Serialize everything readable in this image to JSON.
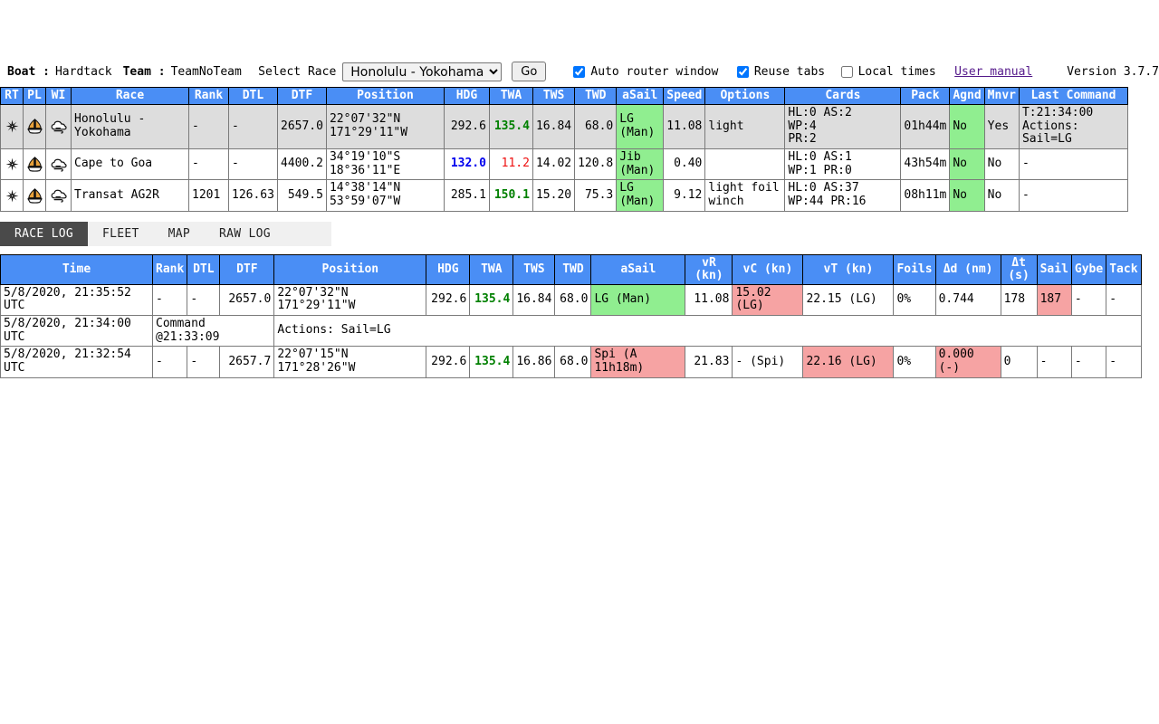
{
  "header": {
    "boat_label": "Boat :",
    "boat_name": "Hardtack",
    "team_label": "Team :",
    "team_name": "TeamNoTeam",
    "select_race_label": "Select Race",
    "selected_race": "Honolulu - Yokohama",
    "race_options": [
      "Honolulu - Yokohama",
      "Cape to Goa",
      "Transat AG2R"
    ],
    "go_label": "Go",
    "auto_router_window_label": "Auto router window",
    "auto_router_window_checked": true,
    "reuse_tabs_label": "Reuse tabs",
    "reuse_tabs_checked": true,
    "local_times_label": "Local times",
    "local_times_checked": false,
    "user_manual_label": "User manual",
    "version_label": "Version 3.7.7"
  },
  "colors": {
    "header_blue": "#4a8ef5",
    "highlight_green": "#90ee90",
    "highlight_pink": "#f6a3a3",
    "row_highlight": "#dddddd",
    "active_tab": "#4a4a4a",
    "value_green": "#008000",
    "value_red": "#ee1111",
    "value_blue": "#0000ee"
  },
  "fleet_table": {
    "columns": [
      "RT",
      "PL",
      "WI",
      "Race",
      "Rank",
      "DTL",
      "DTF",
      "Position",
      "HDG",
      "TWA",
      "TWS",
      "TWD",
      "aSail",
      "Speed",
      "Options",
      "Cards",
      "Pack",
      "Agnd",
      "Mnvr",
      "Last Command"
    ],
    "rows": [
      {
        "selected": true,
        "rt_icon": "compass-rose-icon",
        "pl_icon": "sailboat-icon",
        "wi_icon": "wind-cloud-icon",
        "race": "Honolulu - Yokohama",
        "rank": "-",
        "dtl": "-",
        "dtf": "2657.0",
        "position_lat": "22°07'32\"N",
        "position_lon": "171°29'11\"W",
        "hdg": "292.6",
        "hdg_color": "normal",
        "twa": "135.4",
        "twa_color": "green",
        "tws": "16.84",
        "twd": "68.0",
        "asail": "LG (Man)",
        "asail_hl": "green",
        "speed": "11.08",
        "options": "light",
        "cards": "HL:0 AS:2 WP:4 PR:2",
        "pack": "01h44m",
        "agnd": "No",
        "agnd_hl": "green",
        "mnvr": "Yes",
        "last_command": "T:21:34:00 Actions: Sail=LG"
      },
      {
        "selected": false,
        "rt_icon": "compass-rose-icon",
        "pl_icon": "sailboat-icon",
        "wi_icon": "wind-cloud-icon",
        "race": "Cape to Goa",
        "rank": "-",
        "dtl": "-",
        "dtf": "4400.2",
        "position_lat": "34°19'10\"S",
        "position_lon": "18°36'11\"E",
        "hdg": "132.0",
        "hdg_color": "blue",
        "twa": "11.2",
        "twa_color": "red",
        "tws": "14.02",
        "twd": "120.8",
        "asail": "Jib (Man)",
        "asail_hl": "green",
        "speed": "0.40",
        "options": "",
        "cards": "HL:0 AS:1 WP:1 PR:0",
        "pack": "43h54m",
        "agnd": "No",
        "agnd_hl": "green",
        "mnvr": "No",
        "last_command": "-"
      },
      {
        "selected": false,
        "rt_icon": "compass-rose-icon",
        "pl_icon": "sailboat-icon",
        "wi_icon": "wind-cloud-icon",
        "race": "Transat AG2R",
        "rank": "1201",
        "dtl": "126.63",
        "dtf": "549.5",
        "position_lat": "14°38'14\"N",
        "position_lon": "53°59'07\"W",
        "hdg": "285.1",
        "hdg_color": "normal",
        "twa": "150.1",
        "twa_color": "green",
        "tws": "15.20",
        "twd": "75.3",
        "asail": "LG (Man)",
        "asail_hl": "green",
        "speed": "9.12",
        "options": "light foil winch",
        "cards": "HL:0 AS:37 WP:44 PR:16",
        "pack": "08h11m",
        "agnd": "No",
        "agnd_hl": "green",
        "mnvr": "No",
        "last_command": "-"
      }
    ]
  },
  "tabs": [
    {
      "label": "RACE LOG",
      "active": true
    },
    {
      "label": "FLEET",
      "active": false
    },
    {
      "label": "MAP",
      "active": false
    },
    {
      "label": "RAW LOG",
      "active": false
    }
  ],
  "race_log": {
    "columns": [
      "Time",
      "Rank",
      "DTL",
      "DTF",
      "Position",
      "HDG",
      "TWA",
      "TWS",
      "TWD",
      "aSail",
      "vR (kn)",
      "vC (kn)",
      "vT (kn)",
      "Foils",
      "Δd (nm)",
      "Δt (s)",
      "Sail",
      "Gybe",
      "Tack"
    ],
    "rows": [
      {
        "type": "data",
        "time": "5/8/2020, 21:35:52 UTC",
        "rank": "-",
        "dtl": "-",
        "dtf": "2657.0",
        "position_lat": "22°07'32\"N",
        "position_lon": "171°29'11\"W",
        "hdg": "292.6",
        "twa": "135.4",
        "twa_color": "green",
        "tws": "16.84",
        "twd": "68.0",
        "asail": "LG (Man)",
        "asail_hl": "green",
        "vr": "11.08",
        "vc": "15.02 (LG)",
        "vc_hl": "pink",
        "vt": "22.15 (LG)",
        "foils": "0%",
        "dd": "0.744",
        "dt": "178",
        "sail": "187",
        "sail_hl": "pink",
        "gybe": "-",
        "tack": "-"
      },
      {
        "type": "command",
        "time": "5/8/2020, 21:34:00 UTC",
        "command_label": "Command @21:33:09",
        "actions": "Actions: Sail=LG"
      },
      {
        "type": "data",
        "time": "5/8/2020, 21:32:54 UTC",
        "rank": "-",
        "dtl": "-",
        "dtf": "2657.7",
        "position_lat": "22°07'15\"N",
        "position_lon": "171°28'26\"W",
        "hdg": "292.6",
        "twa": "135.4",
        "twa_color": "green",
        "tws": "16.86",
        "twd": "68.0",
        "asail": "Spi (A 11h18m)",
        "asail_hl": "pink",
        "vr": "21.83",
        "vc": "- (Spi)",
        "vc_hl": "none",
        "vt": "22.16 (LG)",
        "vt_hl": "pink",
        "foils": "0%",
        "dd": "0.000 (-)",
        "dd_hl": "pink",
        "dt": "0",
        "sail": "-",
        "sail_hl": "none",
        "gybe": "-",
        "tack": "-"
      }
    ]
  }
}
